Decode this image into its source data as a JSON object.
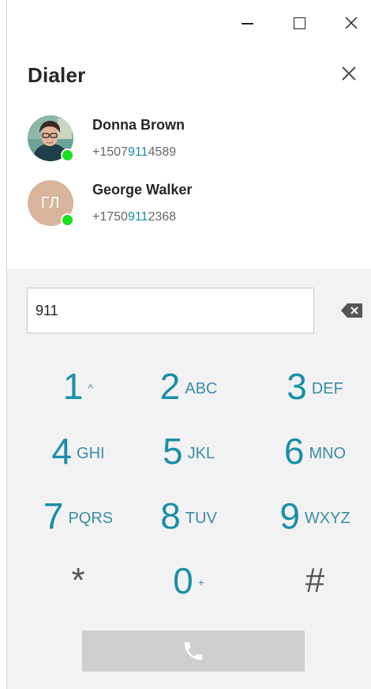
{
  "window": {
    "minimize_icon": "minimize-icon",
    "maximize_icon": "maximize-icon",
    "close_icon": "close-icon"
  },
  "header": {
    "title": "Dialer",
    "close_icon": "close-icon"
  },
  "contacts": [
    {
      "name": "Donna Brown",
      "phone_prefix": "+1507",
      "phone_match": "911",
      "phone_suffix": "4589",
      "avatar": "photo",
      "status": "online",
      "status_color": "#19e01c"
    },
    {
      "name": "George Walker",
      "initials": "ГЛ",
      "phone_prefix": "+1750",
      "phone_match": "911",
      "phone_suffix": "2368",
      "avatar_color": "#d8b49c",
      "status": "online",
      "status_color": "#19e01c"
    }
  ],
  "dialpad": {
    "input_value": "911",
    "backspace_icon": "backspace-icon",
    "keys": [
      {
        "digit": "1",
        "letters": "^"
      },
      {
        "digit": "2",
        "letters": "ABC"
      },
      {
        "digit": "3",
        "letters": "DEF"
      },
      {
        "digit": "4",
        "letters": "GHI"
      },
      {
        "digit": "5",
        "letters": "JKL"
      },
      {
        "digit": "6",
        "letters": "MNO"
      },
      {
        "digit": "7",
        "letters": "PQRS"
      },
      {
        "digit": "8",
        "letters": "TUV"
      },
      {
        "digit": "9",
        "letters": "WXYZ"
      },
      {
        "digit": "*",
        "letters": ""
      },
      {
        "digit": "0",
        "letters": "+"
      },
      {
        "digit": "#",
        "letters": ""
      }
    ],
    "call_icon": "phone-icon"
  },
  "colors": {
    "accent": "#1a8fa8",
    "pad_background": "#f2f2f2",
    "call_button": "#cfcfcf",
    "online": "#19e01c"
  }
}
